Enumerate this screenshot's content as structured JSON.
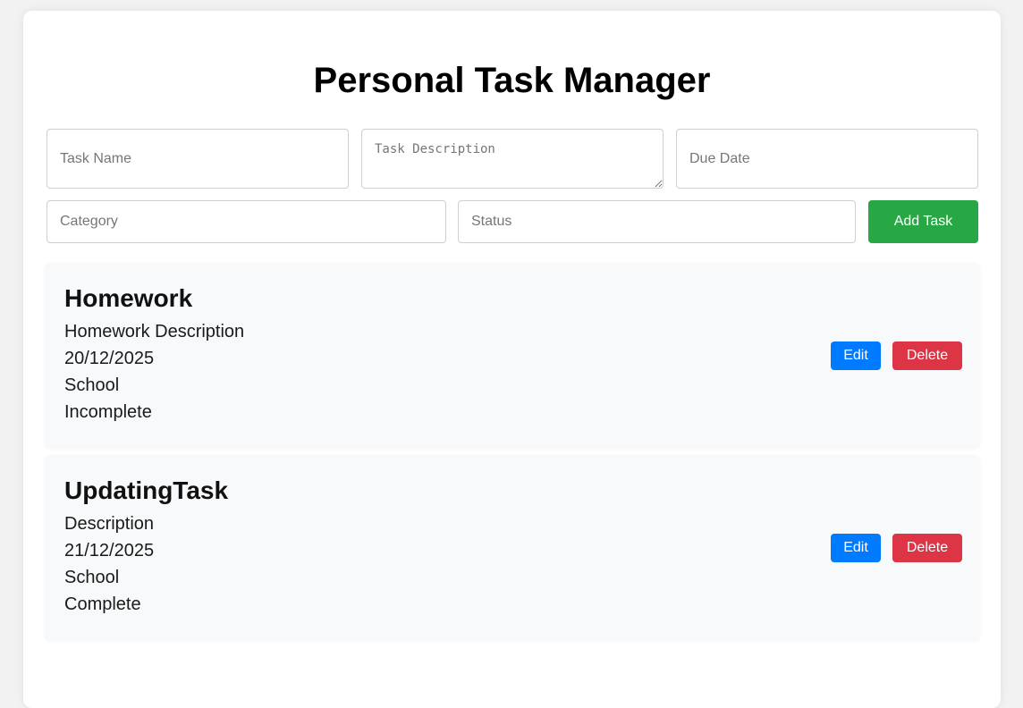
{
  "page": {
    "title": "Personal Task Manager"
  },
  "form": {
    "task_name": {
      "value": "",
      "placeholder": "Task Name"
    },
    "task_description": {
      "value": "",
      "placeholder": "Task Description"
    },
    "due_date": {
      "value": "",
      "placeholder": "Due Date"
    },
    "category": {
      "value": "",
      "placeholder": "Category"
    },
    "status": {
      "value": "",
      "placeholder": "Status"
    },
    "add_button_label": "Add Task"
  },
  "tasks": [
    {
      "name": "Homework",
      "description": "Homework Description",
      "due_date": "20/12/2025",
      "category": "School",
      "status": "Incomplete",
      "edit_label": "Edit",
      "delete_label": "Delete"
    },
    {
      "name": "UpdatingTask",
      "description": "Description",
      "due_date": "21/12/2025",
      "category": "School",
      "status": "Complete",
      "edit_label": "Edit",
      "delete_label": "Delete"
    }
  ],
  "colors": {
    "add": "#28a745",
    "edit": "#007bff",
    "delete": "#dc3545"
  }
}
